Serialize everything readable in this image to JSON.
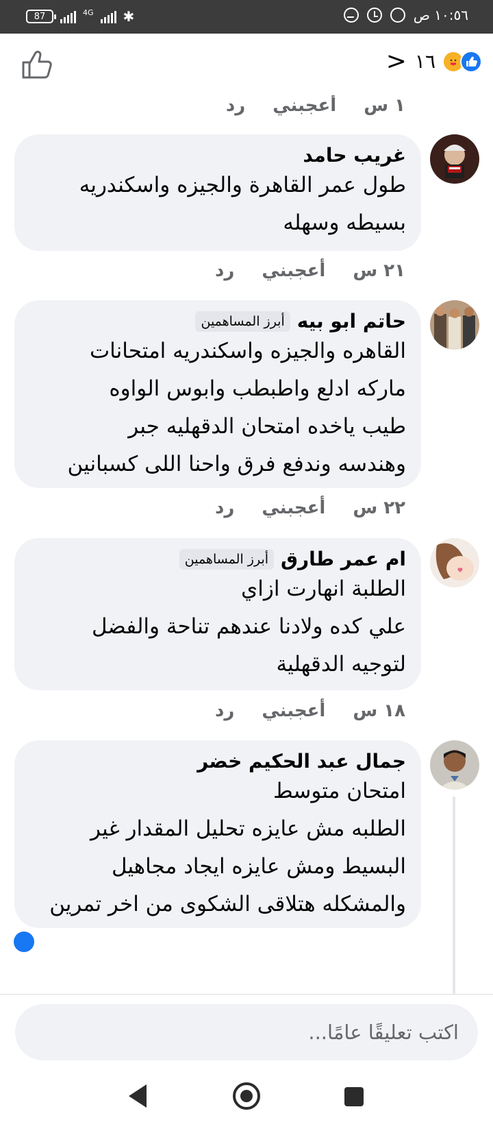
{
  "status_bar": {
    "battery": "87",
    "network": "4G",
    "time": "١٠:٥٦ ص"
  },
  "header": {
    "reaction_count": "١٦",
    "back_glyph": "<"
  },
  "comments": [
    {
      "time": "١ س",
      "like_label": "أعجبني",
      "reply_label": "رد"
    },
    {
      "author": "غريب حامد",
      "badge": "",
      "text": "طول عمر القاهرة والجيزه واسكندريه\nبسيطه وسهله",
      "time": "٢١ س",
      "like_label": "أعجبني",
      "reply_label": "رد"
    },
    {
      "author": "حاتم ابو بيه",
      "badge": "أبرز المساهمين",
      "text": "القاهره والجيزه واسكندريه امتحانات\nماركه ادلع واطبطب وابوس الواوه\nطيب ياخده امتحان الدقهليه جبر\nوهندسه وندفع فرق واحنا اللى كسبانين",
      "time": "٢٢ س",
      "like_label": "أعجبني",
      "reply_label": "رد"
    },
    {
      "author": "ام عمر طارق",
      "badge": "أبرز المساهمين",
      "text": "الطلبة انهارت ازاي\nعلي كده ولادنا عندهم تناحة والفضل\nلتوجيه الدقهلية",
      "time": "١٨ س",
      "like_label": "أعجبني",
      "reply_label": "رد"
    },
    {
      "author": "جمال عبد الحكيم خضر",
      "badge": "",
      "text": "امتحان  متوسط\nالطلبه مش عايزه تحليل المقدار غير\nالبسيط  ومش عايزه ايجاد مجاهيل\nوالمشكله هتلاقى الشكوى من اخر تمرين"
    }
  ],
  "composer": {
    "placeholder": "اكتب تعليقًا عامًا..."
  },
  "icons": {
    "like": "thumbs-up-icon",
    "care": "care-reaction-icon"
  },
  "colors": {
    "accent": "#1877f2",
    "bubble": "#f0f2f5",
    "meta_text": "#65676b"
  }
}
